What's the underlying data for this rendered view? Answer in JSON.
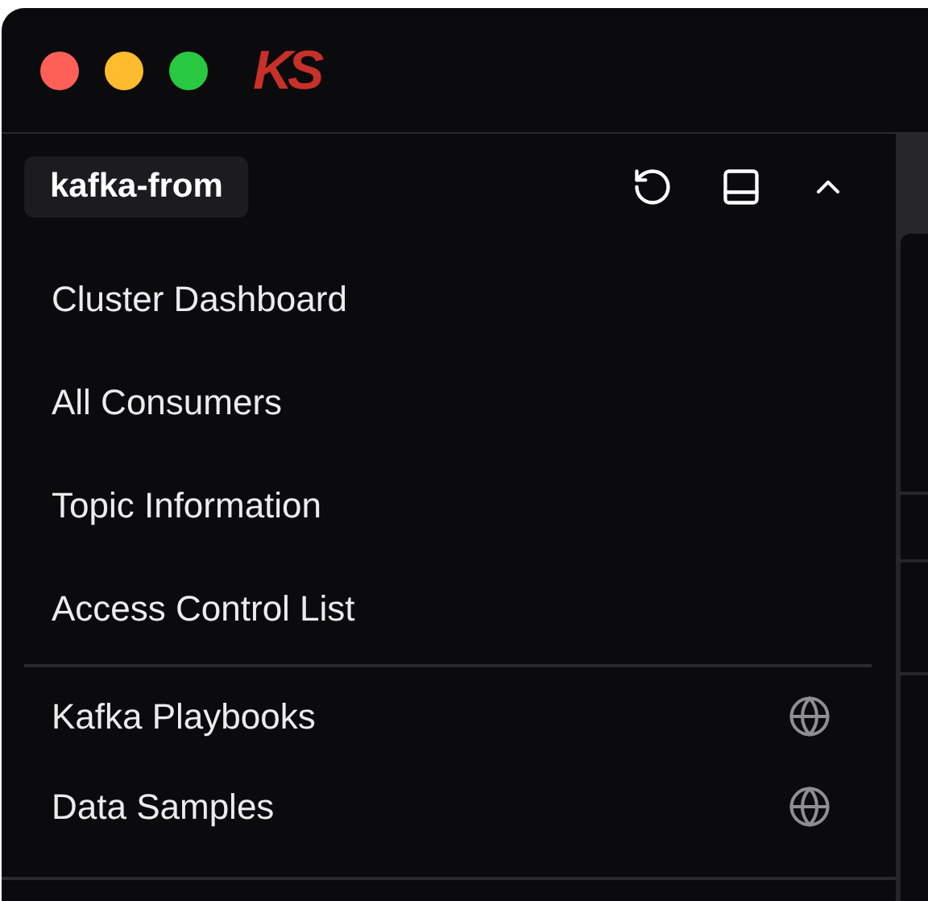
{
  "title_bar": {
    "logo": "KS"
  },
  "sidebar": {
    "workspace": "kafka-from",
    "nav_items": [
      {
        "label": "Cluster Dashboard"
      },
      {
        "label": "All Consumers"
      },
      {
        "label": "Topic Information"
      },
      {
        "label": "Access Control List"
      }
    ],
    "external_links": [
      {
        "label": "Kafka Playbooks"
      },
      {
        "label": "Data Samples"
      }
    ]
  }
}
